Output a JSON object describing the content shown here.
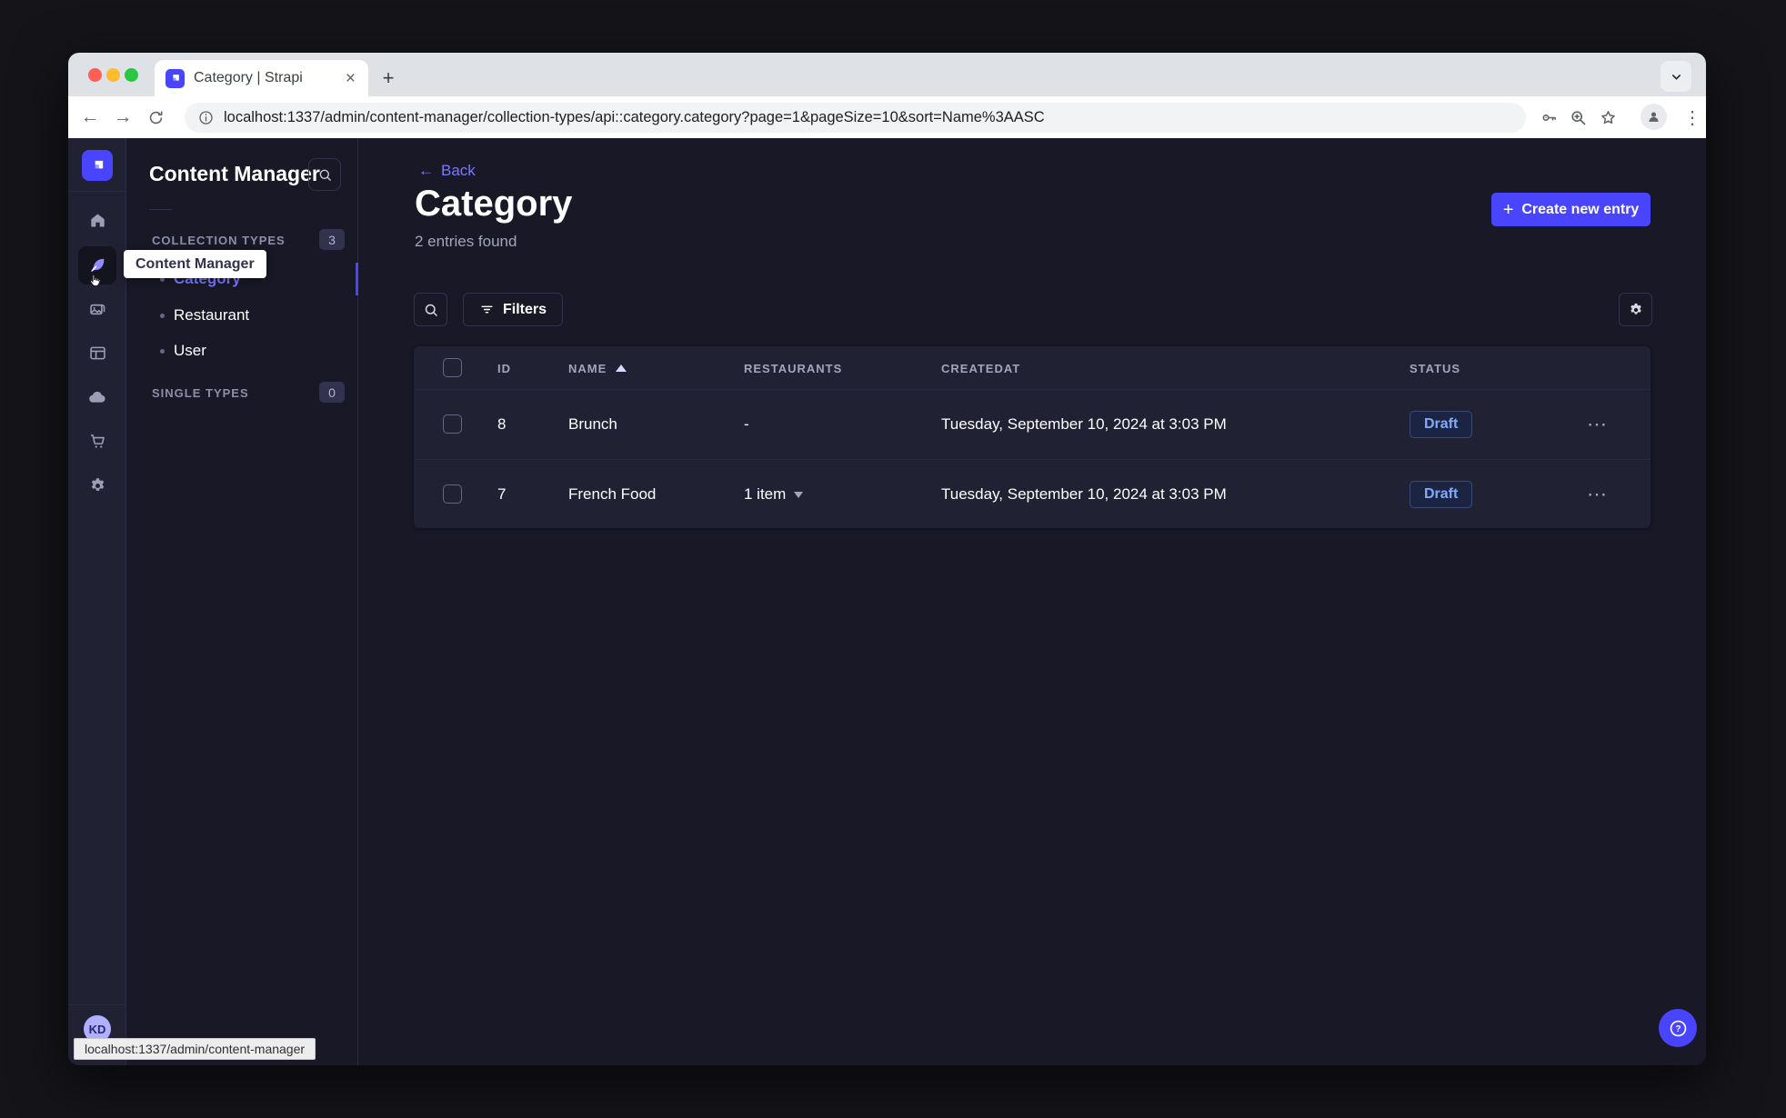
{
  "browser": {
    "tab_title": "Category | Strapi",
    "url": "localhost:1337/admin/content-manager/collection-types/api::category.category?page=1&pageSize=10&sort=Name%3AASC",
    "status_bar_url": "localhost:1337/admin/content-manager"
  },
  "icons": {
    "new_tab_glyph": "+",
    "close_glyph": "×",
    "kebab_glyph": "⋮",
    "row_actions_glyph": "⋯",
    "back_glyph": "←",
    "forward_glyph": "→",
    "plus_glyph": "+"
  },
  "rail": {
    "icon_names": [
      "strapi-logo",
      "home",
      "content-manager",
      "media-library",
      "content-type-builder",
      "cloud",
      "marketplace",
      "settings"
    ],
    "active_icon": "content-manager",
    "avatar_initials": "KD"
  },
  "subnav": {
    "title": "Content Manager",
    "sections": [
      {
        "label": "COLLECTION TYPES",
        "badge": "3"
      },
      {
        "label": "SINGLE TYPES",
        "badge": "0"
      }
    ],
    "items": [
      {
        "label": "Category",
        "active": true
      },
      {
        "label": "Restaurant",
        "active": false
      },
      {
        "label": "User",
        "active": false
      }
    ]
  },
  "tooltip": {
    "label": "Content Manager"
  },
  "main": {
    "back_label": "Back",
    "title": "Category",
    "subtitle": "2 entries found",
    "create_button_label": "Create new entry",
    "filters_button_label": "Filters",
    "table": {
      "headers": {
        "id": "ID",
        "name": "NAME",
        "restaurants": "RESTAURANTS",
        "createdat": "CREATEDAT",
        "status": "STATUS"
      },
      "sorted_by": "NAME",
      "sort_direction": "asc",
      "rows": [
        {
          "id": "8",
          "name": "Brunch",
          "restaurants": "-",
          "createdat": "Tuesday, September 10, 2024 at 3:03 PM",
          "status": "Draft"
        },
        {
          "id": "7",
          "name": "French Food",
          "restaurants": "1 item",
          "createdat": "Tuesday, September 10, 2024 at 3:03 PM",
          "status": "Draft"
        }
      ]
    }
  },
  "colors": {
    "accent": "#4945ff",
    "link": "#7b79ff",
    "panel": "#212134",
    "app_background": "#181826",
    "draft_text": "#84a9f9"
  }
}
